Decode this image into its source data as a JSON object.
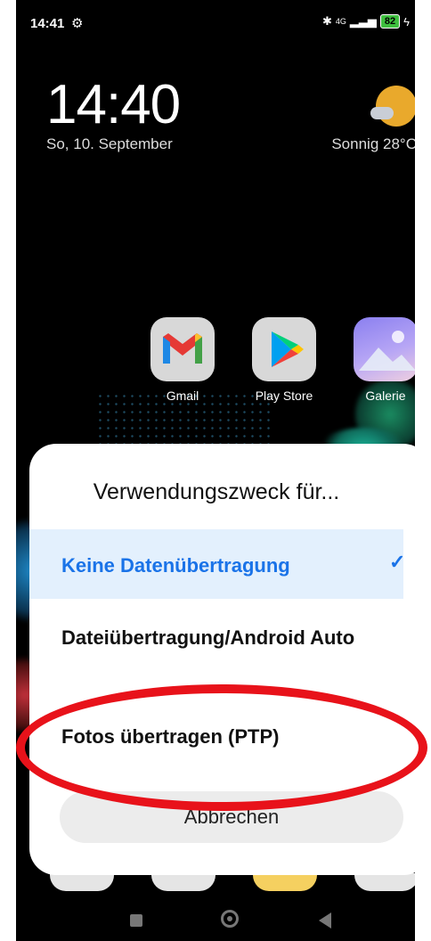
{
  "status_bar": {
    "time": "14:41",
    "icons": [
      "settings-gear-icon",
      "bluetooth-icon",
      "4g-icon",
      "signal-icon"
    ],
    "network": "4G",
    "battery": "82"
  },
  "lockscreen": {
    "clock": "14:40",
    "date": "So, 10. September",
    "weather": "Sonnig  28°C",
    "weather_icon": "sun-cloud-icon"
  },
  "apps": [
    {
      "label": "Gmail",
      "icon": "gmail-icon"
    },
    {
      "label": "Play Store",
      "icon": "play-store-icon"
    },
    {
      "label": "Galerie",
      "icon": "gallery-icon"
    }
  ],
  "dialog": {
    "title": "Verwendungszweck für...",
    "options": [
      {
        "label": "Keine Datenübertragung",
        "selected": true
      },
      {
        "label": "Dateiübertragung/Android Auto",
        "selected": false
      },
      {
        "label": "Fotos übertragen (PTP)",
        "selected": false
      }
    ],
    "cancel": "Abbrechen",
    "accent_color": "#1a73e8",
    "selected_bg": "#e3f0fd"
  },
  "annotation": {
    "type": "red-ellipse-highlight",
    "target": "Fotos übertragen (PTP)",
    "color": "#e8121a"
  },
  "nav_bar": [
    "recents-icon",
    "home-icon",
    "back-icon"
  ]
}
